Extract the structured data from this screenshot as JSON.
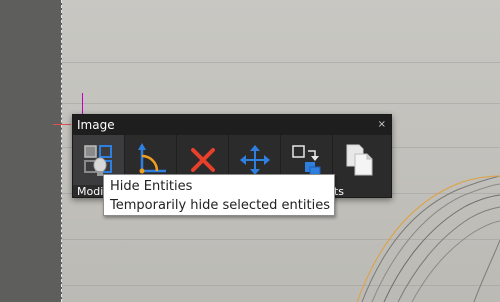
{
  "panel": {
    "title": "Image",
    "close_label": "×",
    "tools": [
      {
        "name": "hide-entities",
        "icon": "hide-entities-icon"
      },
      {
        "name": "align",
        "icon": "corner-angle-icon"
      },
      {
        "name": "delete",
        "icon": "red-x-icon"
      },
      {
        "name": "move",
        "icon": "move-arrows-icon"
      },
      {
        "name": "transfer",
        "icon": "copy-transfer-icon"
      },
      {
        "name": "copy",
        "icon": "documents-icon"
      }
    ],
    "footer_left": "Modi",
    "footer_right": "nts"
  },
  "tooltip": {
    "title": "Hide Entities",
    "description": "Temporarily hide selected entities"
  },
  "colors": {
    "accent_blue": "#2f7fe0",
    "delete_red": "#e8402a",
    "angle_orange": "#f0a020"
  }
}
